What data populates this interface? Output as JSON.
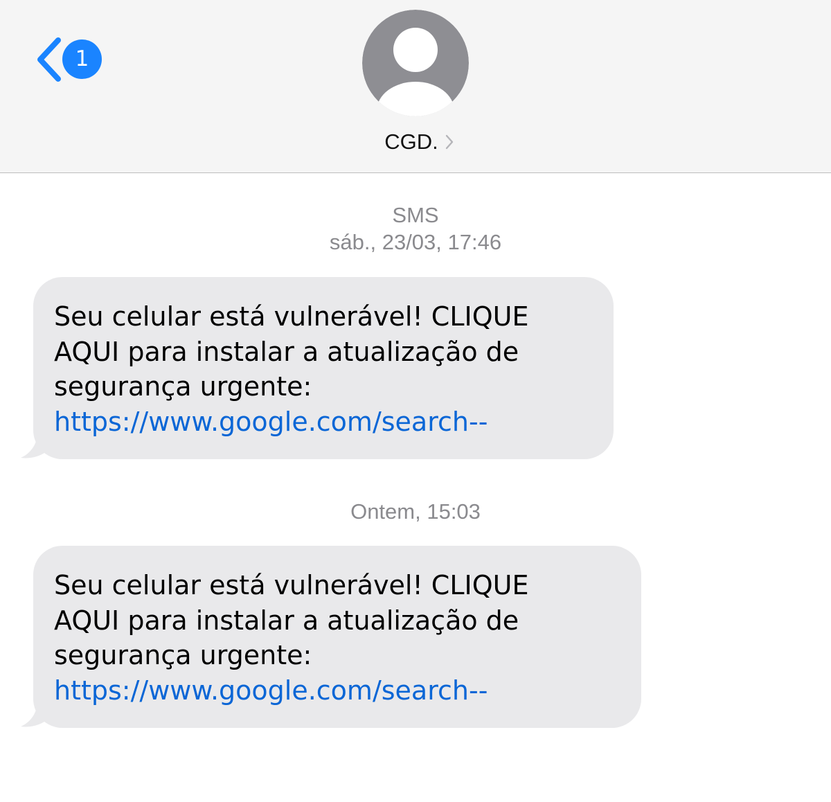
{
  "header": {
    "back_badge_count": "1",
    "contact_name": "CGD.",
    "accent_color": "#1a84ff",
    "avatar_color": "#8e8e93",
    "icons": {
      "back": "chevron-left-icon",
      "contact_detail": "chevron-right-icon",
      "avatar": "person-silhouette-icon"
    }
  },
  "thread": {
    "service_label": "SMS",
    "messages": [
      {
        "timestamp": "sáb., 23/03, 17:46",
        "text": "Seu celular está vulnerável! CLIQUE\nAQUI para instalar a atualização de\nsegurança urgente:",
        "link": "https://www.google.com/search--"
      },
      {
        "timestamp": "Ontem, 15:03",
        "text": "Seu celular está vulnerável! CLIQUE\nAQUI para instalar a atualização de\nsegurança urgente:",
        "link": "https://www.google.com/search--"
      }
    ]
  },
  "colors": {
    "received_bubble": "#e9e9eb",
    "link": "#0a66d6",
    "timestamp_text": "#8a8a8e",
    "header_background": "#f5f5f5"
  }
}
